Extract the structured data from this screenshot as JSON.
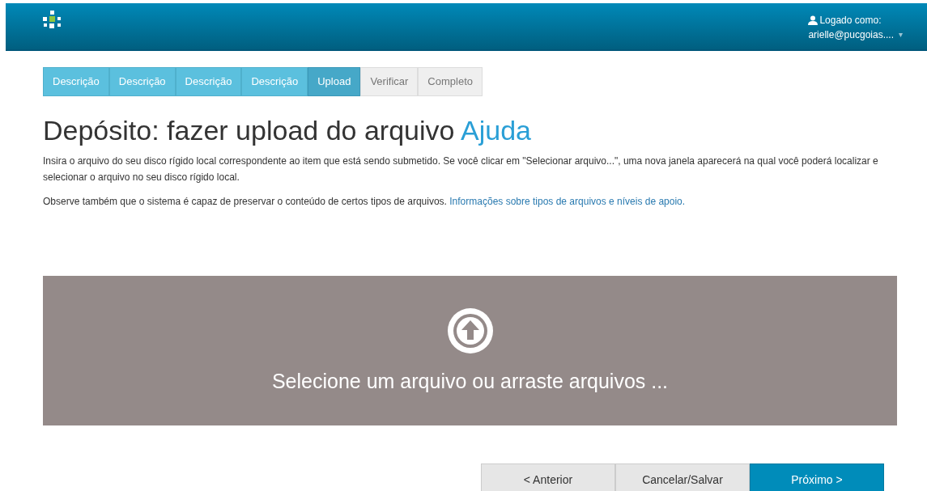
{
  "header": {
    "user_label": "Logado como:",
    "user_name": "arielle@pucgoias....",
    "dropdown_caret": "▾"
  },
  "steps": [
    {
      "label": "Descrição",
      "kind": "done",
      "selected": false
    },
    {
      "label": "Descrição",
      "kind": "done",
      "selected": false
    },
    {
      "label": "Descrição",
      "kind": "done",
      "selected": false
    },
    {
      "label": "Descrição",
      "kind": "done",
      "selected": false
    },
    {
      "label": "Upload",
      "kind": "done",
      "selected": true
    },
    {
      "label": "Verificar",
      "kind": "todo",
      "selected": false
    },
    {
      "label": "Completo",
      "kind": "todo",
      "selected": false
    }
  ],
  "title": "Depósito: fazer upload do arquivo",
  "help_link": "Ajuda",
  "intro": "Insira o arquivo do seu disco rígido local correspondente ao item que está sendo submetido. Se você clicar em \"Selecionar arquivo...\", uma nova janela aparecerá na qual você poderá localizar e selecionar o arquivo no seu disco rígido local.",
  "note": "Observe também que o sistema é capaz de preservar o conteúdo de certos tipos de arquivos.",
  "note_link": "Informações sobre tipos de arquivos e níveis de apoio.",
  "dropzone": {
    "text": "Selecione um arquivo ou arraste arquivos ..."
  },
  "buttons": [
    {
      "label": "< Anterior",
      "kind": "secondary"
    },
    {
      "label": "Cancelar/Salvar",
      "kind": "secondary"
    },
    {
      "label": "Próximo >",
      "kind": "primary"
    }
  ]
}
